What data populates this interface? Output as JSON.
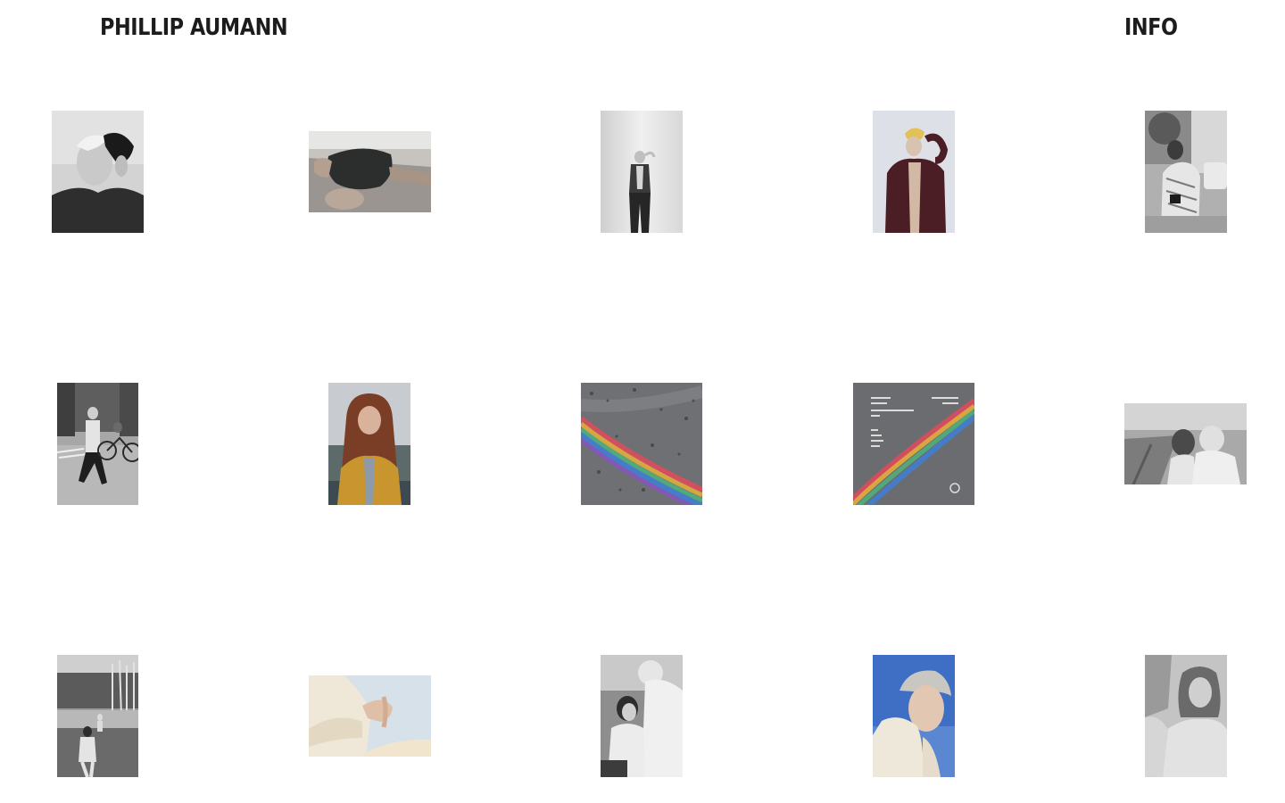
{
  "header": {
    "title": "PHILLIP AUMANN",
    "info_label": "INFO"
  },
  "gallery": {
    "photos": [
      {
        "subject": "bw-portrait-hand-on-head"
      },
      {
        "subject": "hands-holding-dark-fabric"
      },
      {
        "subject": "bw-figure-standing-studio"
      },
      {
        "subject": "blond-figure-burgundy-jacket"
      },
      {
        "subject": "bw-person-street-camera"
      },
      {
        "subject": "bw-person-walking-street-cyclist"
      },
      {
        "subject": "long-hair-woman-yellow-jacket"
      },
      {
        "subject": "oil-rainbow-on-asphalt"
      },
      {
        "subject": "album-cover-oil-rainbow"
      },
      {
        "subject": "bw-two-people-embracing-field"
      },
      {
        "subject": "bw-figures-by-lake-birch-trees"
      },
      {
        "subject": "hand-in-cream-sleeve-sky"
      },
      {
        "subject": "bw-two-people-sitting-close"
      },
      {
        "subject": "woman-cream-turtleneck-blue-sky"
      },
      {
        "subject": "bw-young-woman-portrait"
      }
    ]
  }
}
